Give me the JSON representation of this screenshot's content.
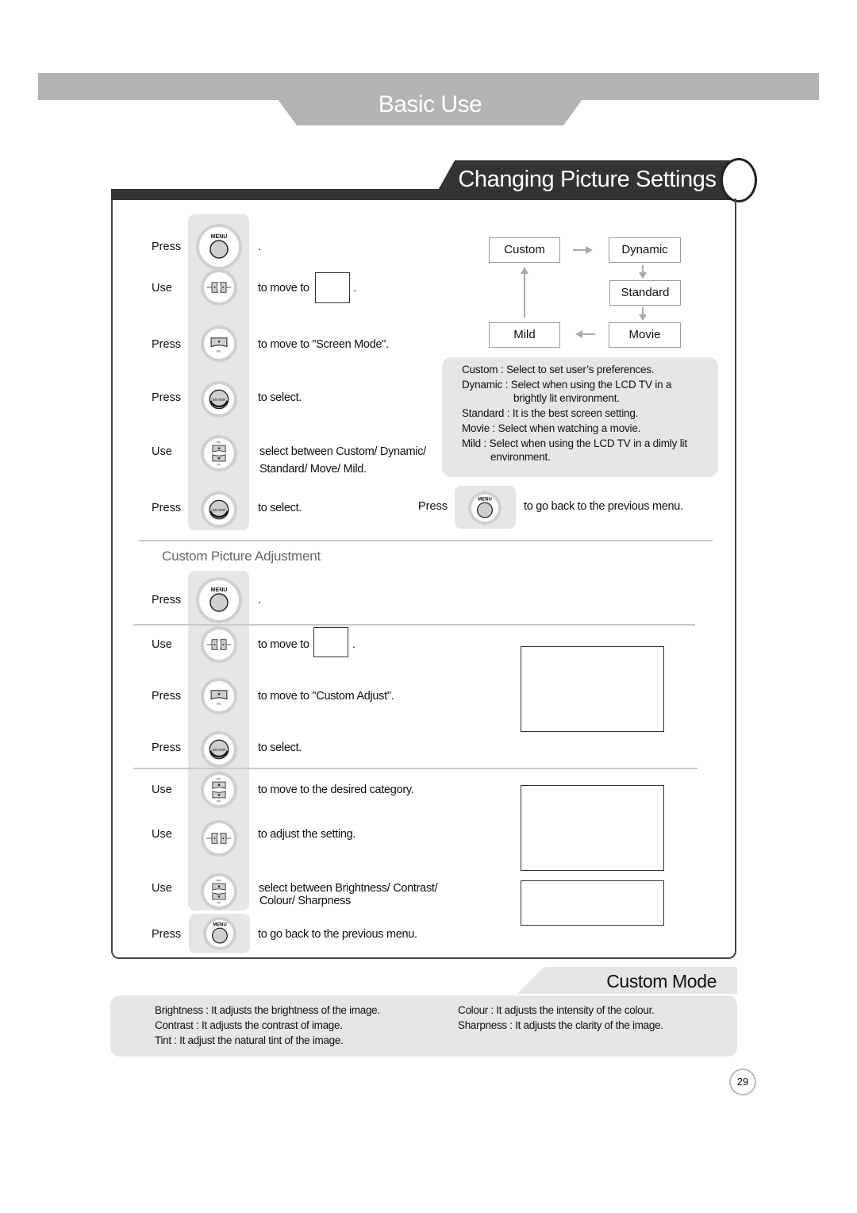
{
  "header": {
    "chapter_title": "Basic Use"
  },
  "section": {
    "title": "Changing Picture Settings"
  },
  "screen_mode_steps": [
    {
      "action": "Press",
      "button": "menu-button",
      "text": "."
    },
    {
      "action": "Use",
      "button": "left-right-button",
      "text": "to move to",
      "after_box": "."
    },
    {
      "action": "Press",
      "button": "down-button",
      "text": "to move to \"Screen Mode\"."
    },
    {
      "action": "Press",
      "button": "enter-button",
      "text": "to select."
    },
    {
      "action": "Use",
      "button": "up-down-button",
      "text": "select between Custom/ Dynamic/",
      "text2": "Standard/ Move/ Mild."
    },
    {
      "action": "Press",
      "button": "enter-button",
      "text": "to select."
    }
  ],
  "back_step": {
    "action": "Press",
    "button": "menu-button",
    "text": "to go back to the previous menu."
  },
  "mode_cycle": {
    "modes": [
      "Custom",
      "Dynamic",
      "Standard",
      "Movie",
      "Mild"
    ]
  },
  "mode_descriptions": [
    "Custom : Select to set user’s preferences.",
    "Dynamic : Select when using the LCD TV  in a",
    "brightly lit environment.",
    "Standard : It is the best screen setting.",
    "Movie : Select when watching a movie.",
    "Mild : Select when using the LCD TV in a dimly lit",
    "environment."
  ],
  "custom_adjust": {
    "title": "Custom Picture Adjustment",
    "steps": [
      {
        "action": "Press",
        "button": "menu-button",
        "text": "."
      },
      {
        "action": "Use",
        "button": "left-right-button",
        "text": "to move to",
        "after_box": "."
      },
      {
        "action": "Press",
        "button": "down-button",
        "text": "to move to \"Custom Adjust\"."
      },
      {
        "action": "Press",
        "button": "enter-button",
        "text": "to select."
      },
      {
        "action": "Use",
        "button": "up-down-button",
        "text": "to  move to the desired category."
      },
      {
        "action": "Use",
        "button": "left-right-button",
        "text": "to adjust the setting."
      },
      {
        "action": "Use",
        "button": "up-down-button",
        "text": "select between Brightness/ Contrast/",
        "text2": "Colour/ Sharpness"
      },
      {
        "action": "Press",
        "button": "menu-button",
        "text": "to go back to the previous menu."
      }
    ]
  },
  "custom_mode": {
    "title": "Custom Mode",
    "left": [
      "Brightness : It adjusts the brightness of the image.",
      "Contrast : It adjusts the contrast of image.",
      "Tint : It adjust the natural tint of the image."
    ],
    "right": [
      "Colour : It adjusts the intensity of the colour.",
      "Sharpness : It adjusts the clarity of the image."
    ]
  },
  "button_labels": {
    "menu": "MENU",
    "enter": "ENTER"
  },
  "page_number": "29",
  "colors": {
    "band": "#b3b3b3",
    "dark": "#333333",
    "panel_grey": "#e6e6e6"
  }
}
